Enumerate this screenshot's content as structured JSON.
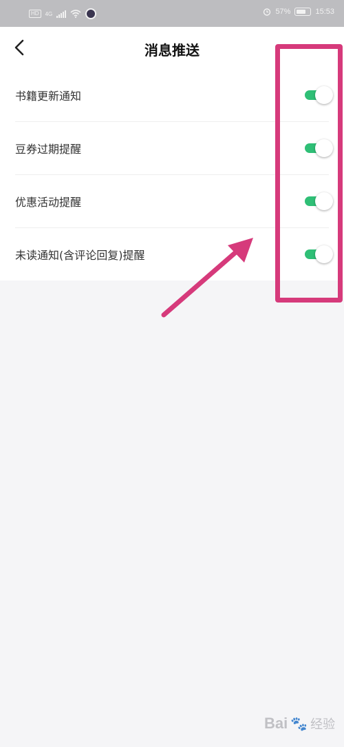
{
  "status_bar": {
    "left_badge": "HD",
    "network_type": "4G",
    "battery_percent": "57%",
    "time": "15:53"
  },
  "header": {
    "title": "消息推送",
    "back_icon": "chevron-left-icon"
  },
  "settings": [
    {
      "label": "书籍更新通知",
      "enabled": true
    },
    {
      "label": "豆券过期提醒",
      "enabled": true
    },
    {
      "label": "优惠活动提醒",
      "enabled": true
    },
    {
      "label": "未读通知(含评论回复)提醒",
      "enabled": true
    }
  ],
  "colors": {
    "toggle_on": "#2fbf76",
    "annotation": "#d63a7b",
    "page_background": "#f5f5f7"
  },
  "watermark": {
    "brand": "Bai",
    "paw_icon": "paw-icon",
    "suffix": "经验"
  }
}
